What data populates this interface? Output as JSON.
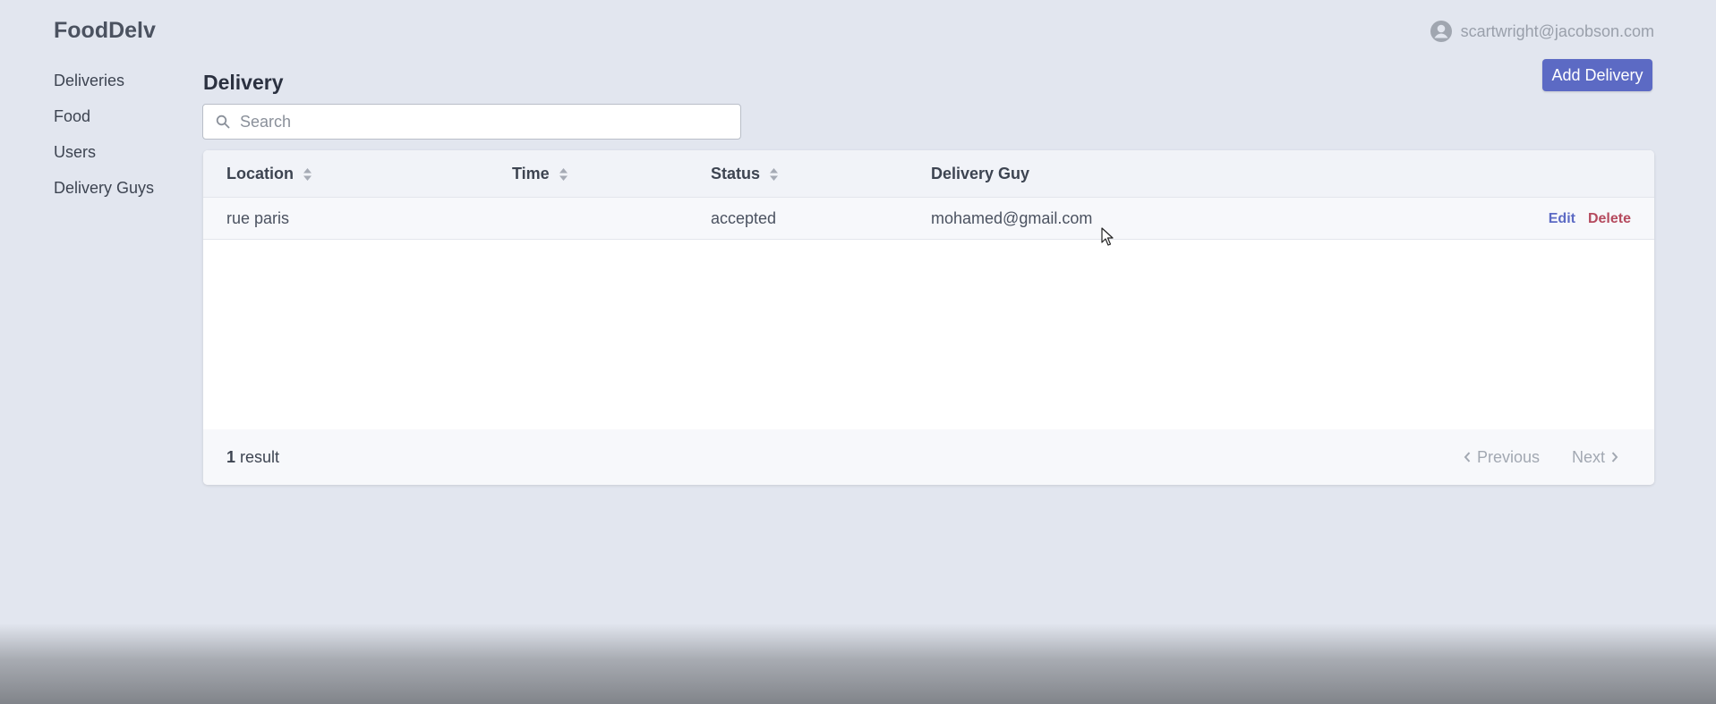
{
  "brand": "FoodDelv",
  "user": {
    "email": "scartwright@jacobson.com",
    "icon": "user-circle-icon"
  },
  "sidebar": {
    "items": [
      {
        "label": "Deliveries"
      },
      {
        "label": "Food"
      },
      {
        "label": "Users"
      },
      {
        "label": "Delivery Guys"
      }
    ]
  },
  "page": {
    "title": "Delivery",
    "add_button": "Add Delivery",
    "search_placeholder": "Search"
  },
  "table": {
    "columns": [
      {
        "label": "Location",
        "sortable": true
      },
      {
        "label": "Time",
        "sortable": true
      },
      {
        "label": "Status",
        "sortable": true
      },
      {
        "label": "Delivery Guy",
        "sortable": false
      }
    ],
    "rows": [
      {
        "location": "rue paris",
        "time": "",
        "status": "accepted",
        "delivery_guy": "mohamed@gmail.com",
        "edit": "Edit",
        "delete": "Delete"
      }
    ],
    "footer": {
      "count": "1",
      "count_suffix": "result",
      "previous": "Previous",
      "next": "Next"
    }
  },
  "colors": {
    "primary": "#5c6ac4",
    "danger": "#b54a5e",
    "background": "#e2e6ef"
  }
}
